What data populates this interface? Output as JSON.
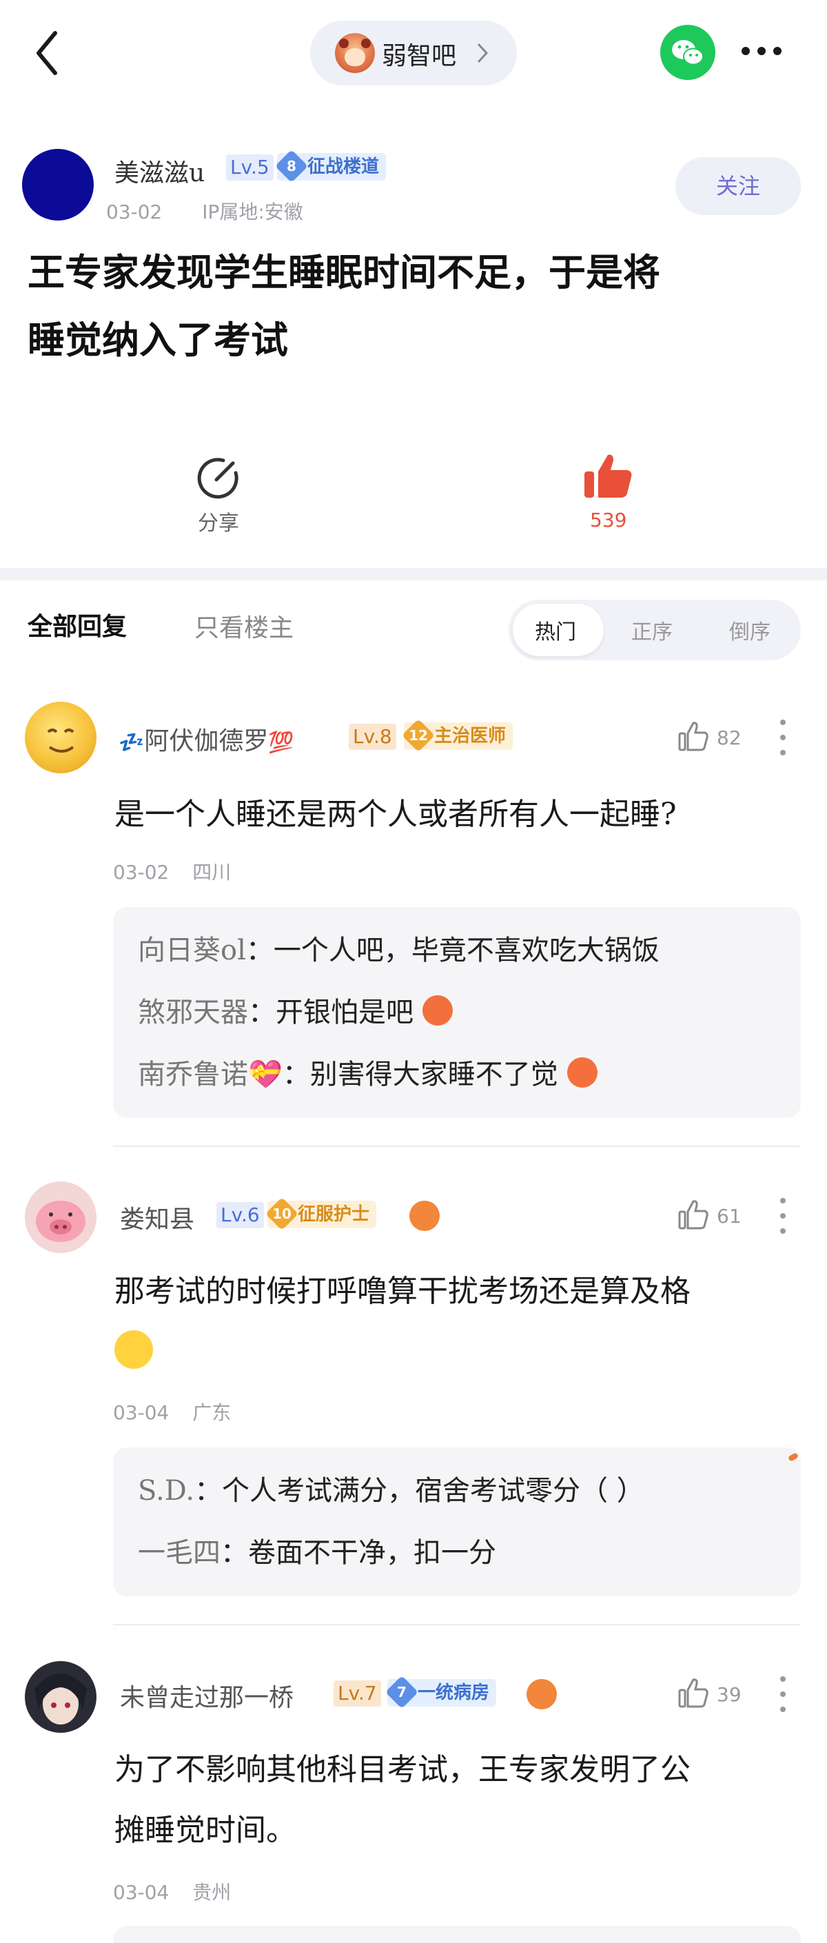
{
  "topbar": {
    "forum_name": "弱智吧"
  },
  "post": {
    "author": "美滋滋u",
    "level": "Lv.5",
    "badge_num": "8",
    "badge_title": "征战楼道",
    "date": "03-02",
    "ip": "IP属地:安徽",
    "follow_label": "关注",
    "title_line1": "王专家发现学生睡眠时间不足，于是将",
    "title_line2": "睡觉纳入了考试",
    "share_label": "分享",
    "like_count": "539"
  },
  "filters": {
    "all": "全部回复",
    "op_only": "只看楼主",
    "hot": "热门",
    "asc": "正序",
    "desc": "倒序"
  },
  "comments": [
    {
      "name_prefix": "💤",
      "name": "阿伏伽德罗",
      "name_suffix": "💯",
      "level": "Lv.8",
      "badge_num": "12",
      "badge_title": "主治医师",
      "likes": "82",
      "text": "是一个人睡还是两个人或者所有人一起睡?",
      "date": "03-02",
      "location": "四川",
      "replies": [
        {
          "who": "向日葵ol",
          "text": "：一个人吧，毕竟不喜欢吃大锅饭"
        },
        {
          "who": "煞邪天器",
          "text": "：开银怕是吧"
        },
        {
          "who": "南乔鲁诺💝",
          "text": "：别害得大家睡不了觉"
        }
      ]
    },
    {
      "name": "娄知县",
      "level": "Lv.6",
      "badge_num": "10",
      "badge_title": "征服护士",
      "likes": "61",
      "text_line1": "那考试的时候打呼噜算干扰考场还是算及格",
      "date": "03-04",
      "location": "广东",
      "replies": [
        {
          "who": "S.D.",
          "text": "：个人考试满分，宿舍考试零分（ ）"
        },
        {
          "who": "一毛四",
          "text": "：卷面不干净，扣一分"
        }
      ]
    },
    {
      "name": "未曾走过那一桥",
      "level": "Lv.7",
      "badge_num": "7",
      "badge_title": "一统病房",
      "likes": "39",
      "text_line1": "为了不影响其他科目考试，王专家发明了公",
      "text_line2": "摊睡觉时间。",
      "date": "03-04",
      "location": "贵州"
    }
  ],
  "colors": {
    "accent_like": "#e8503a",
    "follow_text": "#6d6dd0",
    "wechat": "#1ec95b",
    "level_blue": "#4a6ed6",
    "level_orange": "#e59a2a"
  }
}
